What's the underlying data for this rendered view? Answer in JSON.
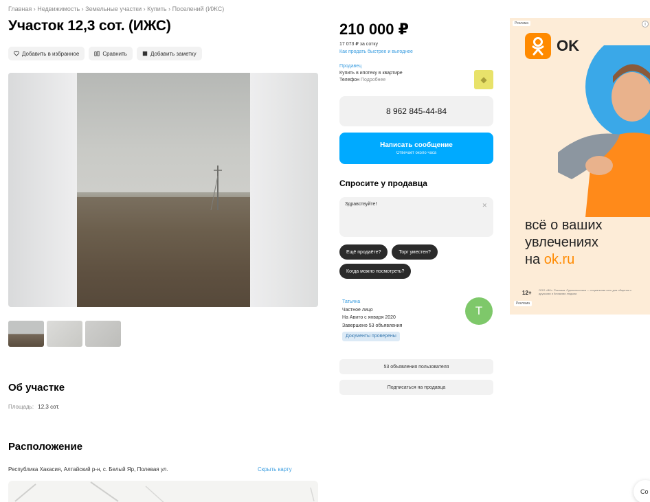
{
  "breadcrumb": "Главная › Недвижимость › Земельные участки › Купить › Поселений (ИЖС)",
  "title": "Участок 12,3 сот. (ИЖС)",
  "actions": [
    {
      "label": "Добавить в избранное",
      "icon": "heart-icon"
    },
    {
      "label": "Сравнить",
      "icon": "compare-icon"
    },
    {
      "label": "Добавить заметку",
      "icon": "note-icon"
    }
  ],
  "about": {
    "heading": "Об участке",
    "area_label": "Площадь:",
    "area_value": "12,3 сот."
  },
  "location": {
    "heading": "Расположение",
    "address": "Республика Хакасия, Алтайский р-н, с. Белый Яр, Полевая ул.",
    "map_link": "Скрыть карту"
  },
  "price": {
    "value": "210 000 ₽",
    "per_unit": "17 073 ₽ за сотку",
    "link": "Как продать быстрее и выгоднее"
  },
  "seller_mini": {
    "name": "Продавец",
    "line1": "Купить в ипотеку в квартире",
    "line2": "Телефон",
    "line2_grey": "Подробнее"
  },
  "phone": "8 962 845-44-84",
  "message": {
    "label": "Написать сообщение",
    "sub": "Отвечает около часа"
  },
  "ask": {
    "heading": "Спросите у продавца",
    "input_value": "Здравствуйте!",
    "chips": [
      "Ещё продаёте?",
      "Торг уместен?",
      "Когда можно посмотреть?"
    ]
  },
  "seller": {
    "name": "Татьяна",
    "type": "Частное лицо",
    "since": "На Авито с января 2020",
    "ads": "Завершено 53 объявления",
    "badge": "Документы проверены",
    "avatar_letter": "Т",
    "buttons": [
      "53 объявления пользователя",
      "Подписаться на продавца"
    ]
  },
  "ad": {
    "label": "Реклама",
    "brand": "OK",
    "slogan_lines": [
      "всё о ваших",
      "увлечениях",
      "на "
    ],
    "slogan_accent": "ok.ru",
    "age": "12+",
    "disclaimer": "ООО «ВК». Реклама. Одноклассники — социальная сеть для общения с друзьями и близкими людьми.",
    "foot": "Реклама"
  },
  "chat_bubble": "Со",
  "colors": {
    "accent_blue": "#00aaff",
    "link_blue": "#3a9de0",
    "ok_orange": "#ff8a00"
  }
}
